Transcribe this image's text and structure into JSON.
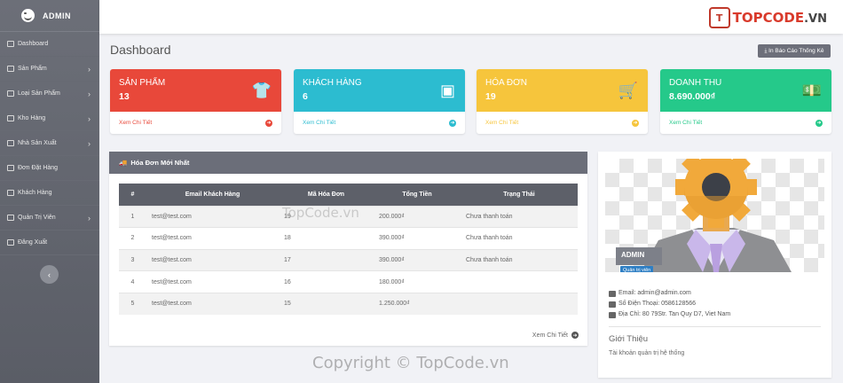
{
  "sidebar": {
    "brand": "ADMIN",
    "items": [
      {
        "label": "Dashboard",
        "icon": "dashboard-icon",
        "has_children": false
      },
      {
        "label": "Sản Phẩm",
        "icon": "box-icon",
        "has_children": true
      },
      {
        "label": "Loại Sản Phẩm",
        "icon": "tag-icon",
        "has_children": true
      },
      {
        "label": "Kho Hàng",
        "icon": "warehouse-icon",
        "has_children": true
      },
      {
        "label": "Nhà Sản Xuất",
        "icon": "factory-icon",
        "has_children": true
      },
      {
        "label": "Đơn Đặt Hàng",
        "icon": "cart-icon",
        "has_children": false
      },
      {
        "label": "Khách Hàng",
        "icon": "users-icon",
        "has_children": false
      },
      {
        "label": "Quản Trị Viên",
        "icon": "admin-icon",
        "has_children": true
      },
      {
        "label": "Đăng Xuất",
        "icon": "logout-icon",
        "has_children": false
      }
    ],
    "collapse_glyph": "‹"
  },
  "topbar": {
    "logo_mark": "T",
    "logo_text": "TOPCODE",
    "logo_domain": ".VN"
  },
  "header": {
    "title": "Dashboard",
    "report_button": "⤓ In Báo Cáo Thống Kê"
  },
  "stats": [
    {
      "label": "SẢN PHẨM",
      "value": "13",
      "link": "Xem Chi Tiết",
      "color": "#e8483a",
      "icon": "tshirt-icon",
      "glyph": "👕"
    },
    {
      "label": "KHÁCH HÀNG",
      "value": "6",
      "link": "Xem Chi Tiết",
      "color": "#2cbcd0",
      "icon": "contact-card-icon",
      "glyph": "▣"
    },
    {
      "label": "HÓA ĐƠN",
      "value": "19",
      "link": "Xem Chi Tiết",
      "color": "#f6c53c",
      "icon": "shopping-cart-icon",
      "glyph": "🛒"
    },
    {
      "label": "DOANH THU",
      "value": "8.690.000₫",
      "link": "Xem Chi Tiết",
      "color": "#25c98a",
      "icon": "money-icon",
      "glyph": "💵"
    }
  ],
  "orders": {
    "title": "Hóa Đơn Mới Nhất",
    "columns": [
      "#",
      "Email Khách Hàng",
      "Mã Hóa Đơn",
      "Tổng Tiền",
      "Trạng Thái"
    ],
    "rows": [
      [
        "1",
        "test@test.com",
        "19",
        "200.000₫",
        "Chưa thanh toán"
      ],
      [
        "2",
        "test@test.com",
        "18",
        "390.000₫",
        "Chưa thanh toán"
      ],
      [
        "3",
        "test@test.com",
        "17",
        "390.000₫",
        "Chưa thanh toán"
      ],
      [
        "4",
        "test@test.com",
        "16",
        "180.000₫",
        ""
      ],
      [
        "5",
        "test@test.com",
        "15",
        "1.250.000₫",
        ""
      ]
    ],
    "see_all": "Xem Chi Tiết"
  },
  "profile": {
    "name": "ADMIN",
    "role": "Quản trị viên",
    "email": "Email: admin@admin.com",
    "phone": "Số Điện Thoại: 0586128566",
    "address": "Địa Chỉ: 80 79Str. Tan Quy D7, Viet Nam",
    "intro_heading": "Giới Thiệu",
    "intro_text": "Tài khoản quản trị hệ thống"
  },
  "watermarks": {
    "bottom": "Copyright © TopCode.vn",
    "table": "TopCode.vn"
  }
}
